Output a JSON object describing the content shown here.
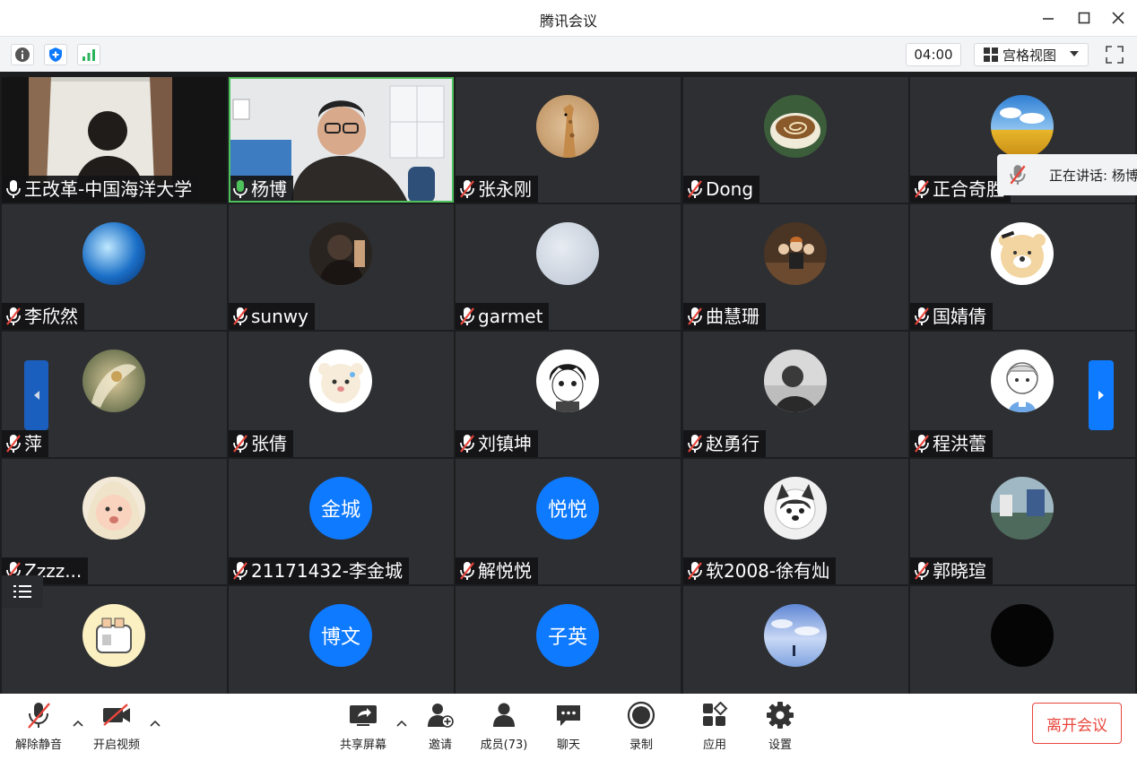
{
  "window": {
    "title": "腾讯会议",
    "minimize_icon": "minimize-icon",
    "maximize_icon": "maximize-icon",
    "close_icon": "close-icon"
  },
  "toolbar": {
    "info_icon": "info-icon",
    "security_icon": "shield-icon",
    "signal_icon": "signal-icon",
    "timer": "04:00",
    "view_label": "宫格视图",
    "fullscreen_icon": "fullscreen-icon"
  },
  "colors": {
    "accent": "#0e7aff",
    "leave": "#e9463c",
    "tile_bg": "#2e2f32",
    "speaking_border": "#4fc25c"
  },
  "speaking": {
    "text": "正在讲话: 杨博"
  },
  "participants": [
    {
      "name": "王改革-中国海洋大学",
      "mic": "on",
      "avatar": "video"
    },
    {
      "name": "杨博",
      "mic": "speaking",
      "avatar": "video"
    },
    {
      "name": "张永刚",
      "mic": "muted",
      "avatar": "giraffe"
    },
    {
      "name": "Dong",
      "mic": "muted",
      "avatar": "coffee"
    },
    {
      "name": "正合奇胜",
      "mic": "muted",
      "avatar": "sky-field"
    },
    {
      "name": "李欣然",
      "mic": "muted",
      "avatar": "blue-light"
    },
    {
      "name": "sunwy",
      "mic": "muted",
      "avatar": "person-dark"
    },
    {
      "name": "garmet",
      "mic": "muted",
      "avatar": "sky-gray"
    },
    {
      "name": "曲慧珊",
      "mic": "muted",
      "avatar": "classroom"
    },
    {
      "name": "国婧倩",
      "mic": "muted",
      "avatar": "bear"
    },
    {
      "name": "萍",
      "mic": "muted",
      "avatar": "painting"
    },
    {
      "name": "张倩",
      "mic": "muted",
      "avatar": "cute-bear"
    },
    {
      "name": "刘镇坤",
      "mic": "muted",
      "avatar": "manga-boy"
    },
    {
      "name": "赵勇行",
      "mic": "muted",
      "avatar": "person-gray"
    },
    {
      "name": "程洪蕾",
      "mic": "muted",
      "avatar": "cartoon-boy"
    },
    {
      "name": "Zzzz...",
      "mic": "muted",
      "avatar": "baby"
    },
    {
      "name": "21171432-李金城",
      "mic": "muted",
      "avatar_text": "金城"
    },
    {
      "name": "解悦悦",
      "mic": "muted",
      "avatar_text": "悦悦"
    },
    {
      "name": "软2008-徐有灿",
      "mic": "muted",
      "avatar": "dog"
    },
    {
      "name": "郭晓瑄",
      "mic": "muted",
      "avatar": "street"
    },
    {
      "name": "",
      "mic": "muted",
      "avatar": "toaster"
    },
    {
      "name": "",
      "mic": "muted",
      "avatar_text": "博文"
    },
    {
      "name": "",
      "mic": "muted",
      "avatar_text": "子英"
    },
    {
      "name": "",
      "mic": "muted",
      "avatar": "night-sky"
    },
    {
      "name": "",
      "mic": "muted",
      "avatar": "dark"
    }
  ],
  "bottombar": {
    "unmute": "解除静音",
    "start_video": "开启视频",
    "share_screen": "共享屏幕",
    "invite": "邀请",
    "members": "成员(73)",
    "chat": "聊天",
    "record": "录制",
    "apps": "应用",
    "settings": "设置",
    "leave": "离开会议"
  }
}
